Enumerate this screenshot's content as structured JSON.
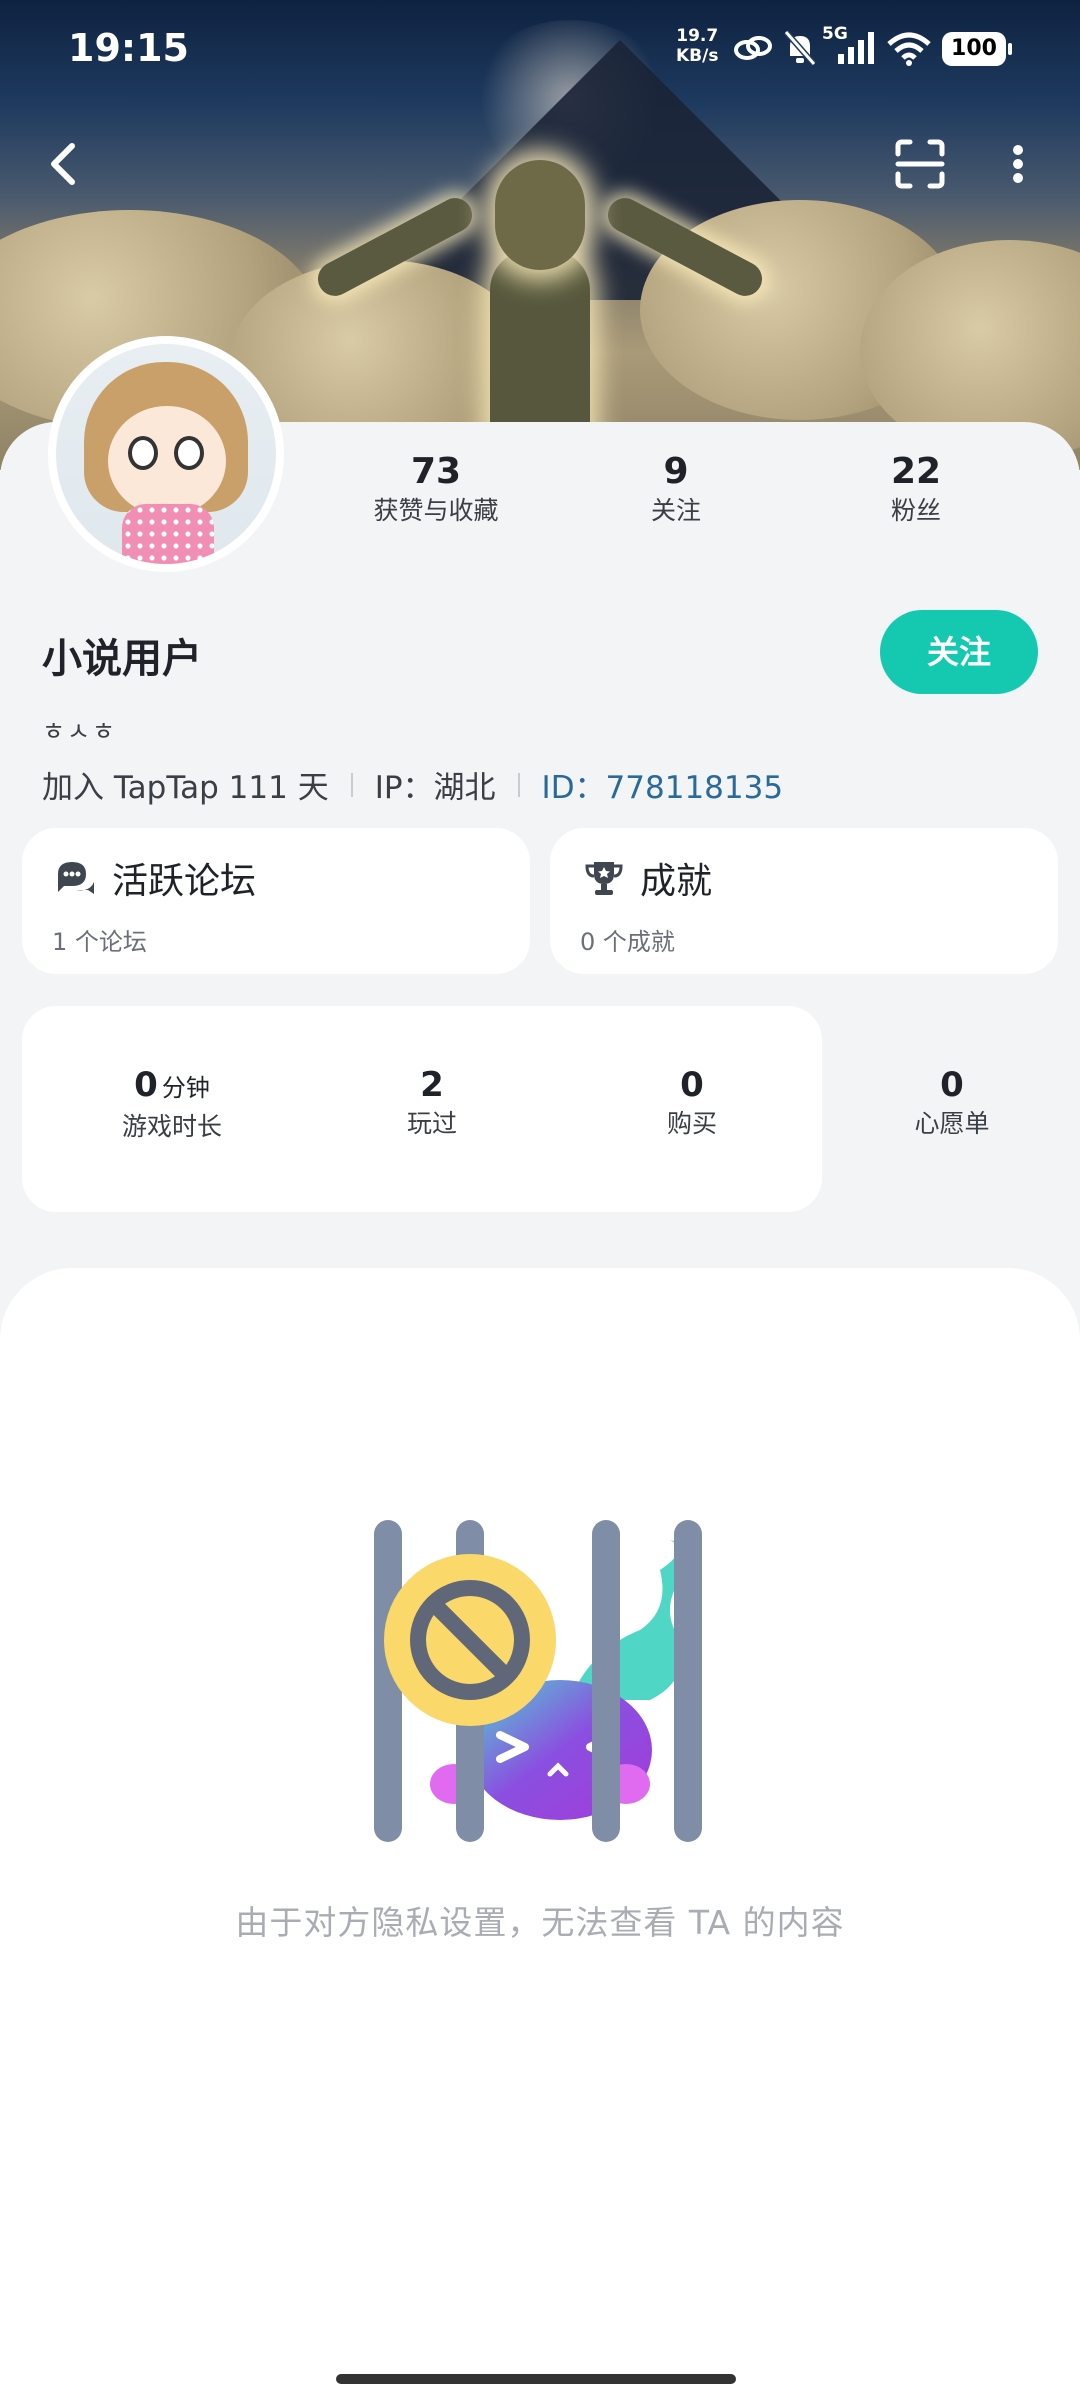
{
  "status_bar": {
    "time": "19:15",
    "net_speed_value": "19.7",
    "net_speed_unit": "KB/s",
    "network": "5G",
    "battery": "100"
  },
  "nav": {
    "back_icon": "chevron-left-icon",
    "scan_icon": "scan-icon",
    "more_icon": "more-vertical-icon"
  },
  "profile": {
    "stats": [
      {
        "value": "73",
        "label": "获赞与收藏"
      },
      {
        "value": "9",
        "label": "关注"
      },
      {
        "value": "22",
        "label": "粉丝"
      }
    ],
    "username": "小说用户",
    "follow_label": "关注",
    "bio": "ㅎㅅㅎ",
    "joined": "加入 TapTap 111 天",
    "ip": "IP：湖北",
    "user_id": "ID：778118135"
  },
  "cards": {
    "forum": {
      "title": "活跃论坛",
      "subtitle": "1 个论坛",
      "icon": "chat-bubble-icon"
    },
    "achievement": {
      "title": "成就",
      "subtitle": "0 个成就",
      "icon": "trophy-icon"
    }
  },
  "game_stats": [
    {
      "value": "0",
      "unit": "分钟",
      "label": "游戏时长"
    },
    {
      "value": "2",
      "unit": "",
      "label": "玩过"
    },
    {
      "value": "0",
      "unit": "",
      "label": "购买"
    },
    {
      "value": "0",
      "unit": "",
      "label": "心愿单"
    }
  ],
  "privacy_message": "由于对方隐私设置，无法查看 TA 的内容",
  "colors": {
    "accent": "#15c8b0",
    "id_link": "#2a6a9a",
    "sheet_bg": "#f3f4f6",
    "muted_text": "#a9adb3"
  }
}
